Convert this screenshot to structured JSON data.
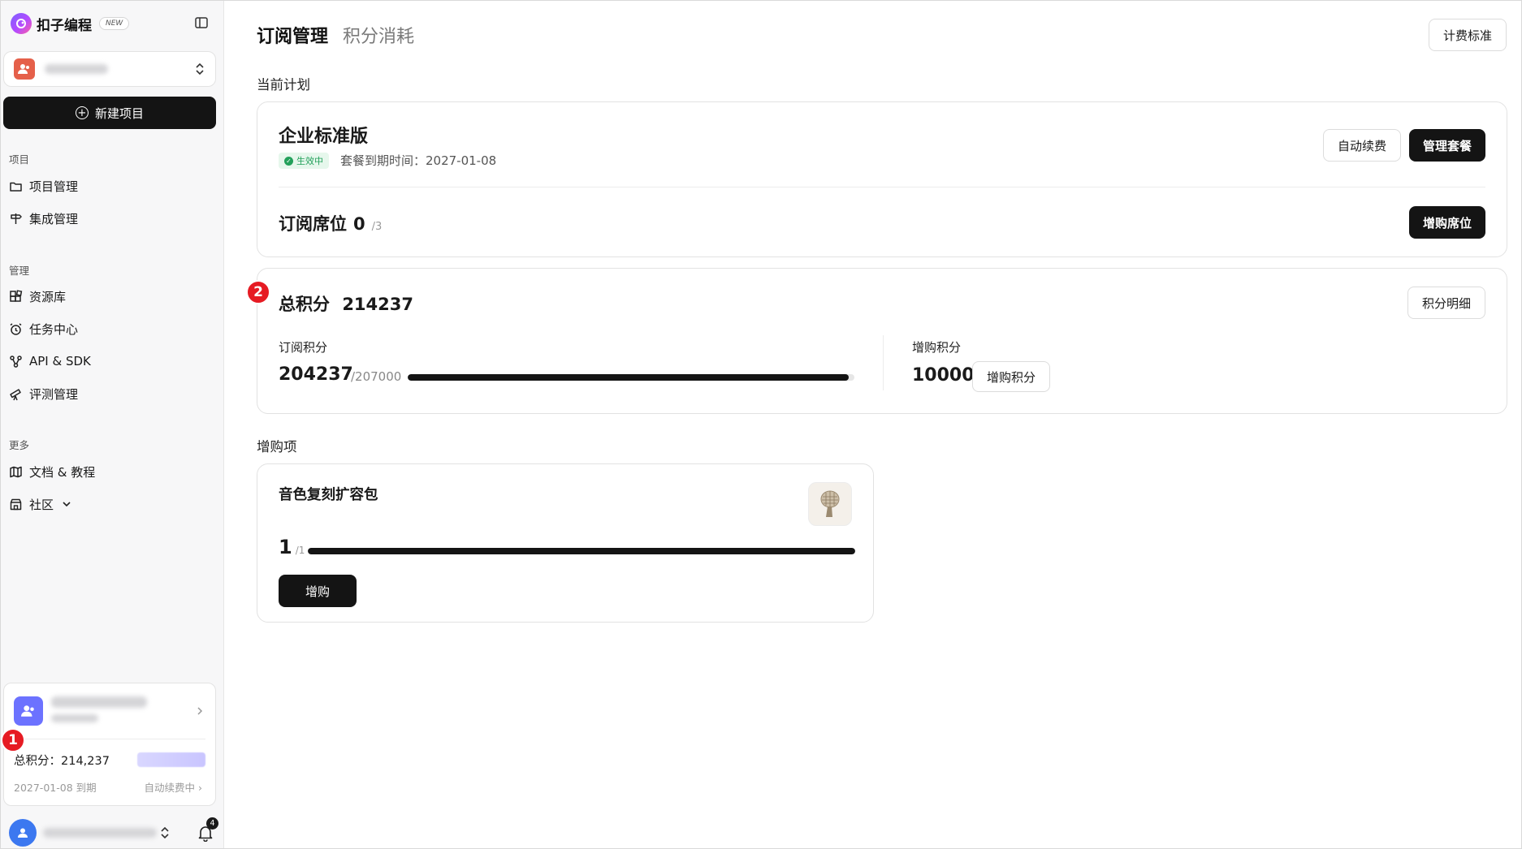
{
  "brand": {
    "name": "扣子编程",
    "badge": "NEW"
  },
  "sidebar": {
    "new_project_label": "新建项目",
    "sections": [
      {
        "label": "项目",
        "items": [
          {
            "label": "项目管理",
            "icon": "folder-icon"
          },
          {
            "label": "集成管理",
            "icon": "signpost-icon"
          }
        ]
      },
      {
        "label": "管理",
        "items": [
          {
            "label": "资源库",
            "icon": "blocks-icon"
          },
          {
            "label": "任务中心",
            "icon": "alarm-icon"
          },
          {
            "label": "API & SDK",
            "icon": "api-icon"
          },
          {
            "label": "评测管理",
            "icon": "telescope-icon"
          }
        ]
      },
      {
        "label": "更多",
        "items": [
          {
            "label": "文档 & 教程",
            "icon": "map-icon"
          },
          {
            "label": "社区",
            "icon": "store-icon"
          }
        ]
      }
    ],
    "account": {
      "credits_label": "总积分：214,237",
      "expire_label": "2027-01-08 到期",
      "renew_label": "自动续费中"
    },
    "notifications_count": "4"
  },
  "main": {
    "tabs": [
      {
        "label": "订阅管理"
      },
      {
        "label": "积分消耗"
      }
    ],
    "pricing_button": "计费标准",
    "current_plan_heading": "当前计划",
    "plan": {
      "name": "企业标准版",
      "status": "生效中",
      "expire_text": "套餐到期时间：2027-01-08",
      "auto_renew_button": "自动续费",
      "manage_button": "管理套餐",
      "seats_label": "订阅席位",
      "seats_used": "0",
      "seats_total": "/3",
      "buy_seats_button": "增购席位"
    },
    "credits": {
      "total_label": "总积分",
      "total_value": "214237",
      "detail_button": "积分明细",
      "subscription_label": "订阅积分",
      "subscription_value": "204237",
      "subscription_total": "/207000",
      "subscription_fraction": 0.9866,
      "purchased_label": "增购积分",
      "purchased_value": "10000",
      "buy_credits_button": "增购积分"
    },
    "addons_heading": "增购项",
    "addon": {
      "name": "音色复刻扩容包",
      "used": "1",
      "total": "/1",
      "fraction": 1.0,
      "buy_button": "增购",
      "thumb_icon": "microphone-icon"
    }
  },
  "markers": [
    "1",
    "2"
  ],
  "colors": {
    "accent_dark": "#141414",
    "status_green": "#22a05a",
    "marker_red": "#e61b23",
    "team_avatar": "#e5604a",
    "account_avatar": "#6c72ff",
    "user_avatar": "#3c78f0"
  }
}
